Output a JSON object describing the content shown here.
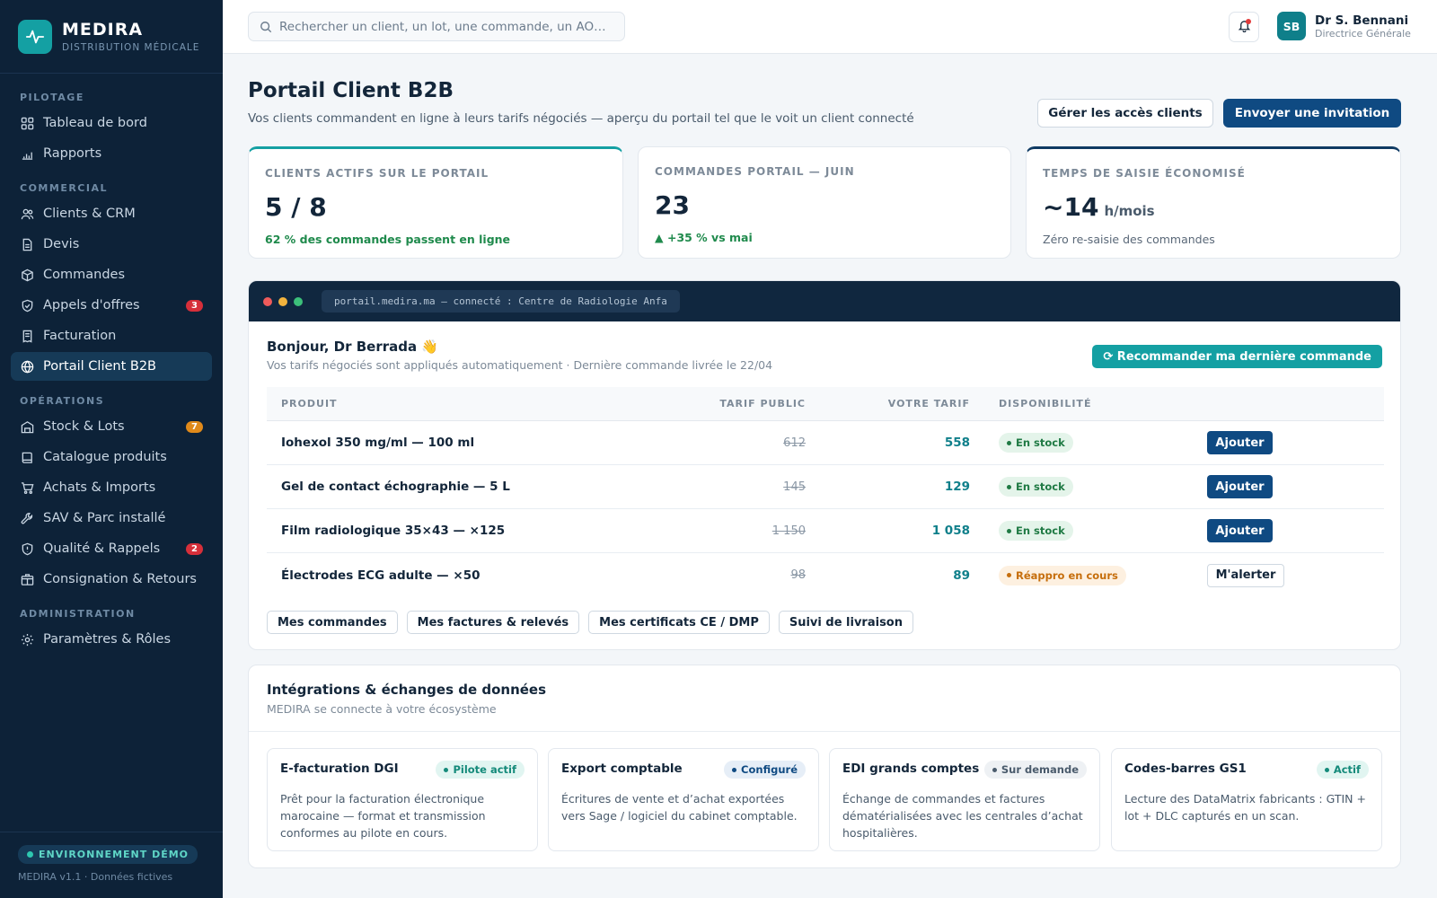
{
  "brand": {
    "name": "MEDIRA",
    "subtitle": "DISTRIBUTION MÉDICALE"
  },
  "sidebar": {
    "sections": [
      {
        "label": "PILOTAGE",
        "items": [
          {
            "label": "Tableau de bord",
            "icon": "grid-icon"
          },
          {
            "label": "Rapports",
            "icon": "bar-chart-icon"
          }
        ]
      },
      {
        "label": "COMMERCIAL",
        "items": [
          {
            "label": "Clients & CRM",
            "icon": "users-icon"
          },
          {
            "label": "Devis",
            "icon": "document-icon"
          },
          {
            "label": "Commandes",
            "icon": "box-icon"
          },
          {
            "label": "Appels d'offres",
            "icon": "shield-check-icon",
            "badge": "3"
          },
          {
            "label": "Facturation",
            "icon": "receipt-icon"
          },
          {
            "label": "Portail Client B2B",
            "icon": "globe-icon",
            "active": true
          }
        ]
      },
      {
        "label": "OPÉRATIONS",
        "items": [
          {
            "label": "Stock & Lots",
            "icon": "warehouse-icon",
            "badge": "7"
          },
          {
            "label": "Catalogue produits",
            "icon": "book-icon"
          },
          {
            "label": "Achats & Imports",
            "icon": "cart-icon"
          },
          {
            "label": "SAV & Parc installé",
            "icon": "wrench-icon"
          },
          {
            "label": "Qualité & Rappels",
            "icon": "shield-icon",
            "badge": "2"
          },
          {
            "label": "Consignation & Retours",
            "icon": "package-icon"
          }
        ]
      },
      {
        "label": "ADMINISTRATION",
        "items": [
          {
            "label": "Paramètres & Rôles",
            "icon": "gear-icon"
          }
        ]
      }
    ],
    "footer": {
      "env": "ENVIRONNEMENT DÉMO",
      "version": "MEDIRA v1.1 · Données fictives"
    }
  },
  "topbar": {
    "search_placeholder": "Rechercher un client, un lot, une commande, un AO…",
    "user": {
      "initials": "SB",
      "name": "Dr S. Bennani",
      "role": "Directrice Générale"
    }
  },
  "page": {
    "title": "Portail Client B2B",
    "subtitle": "Vos clients commandent en ligne à leurs tarifs négociés — aperçu du portail tel que le voit un client connecté",
    "btn_manage": "Gérer les accès clients",
    "btn_invite": "Envoyer une invitation"
  },
  "kpis": [
    {
      "label": "CLIENTS ACTIFS SUR LE PORTAIL",
      "value": "5 / 8",
      "unit": "",
      "note": "62 % des commandes passent en ligne"
    },
    {
      "label": "COMMANDES PORTAIL — JUIN",
      "value": "23",
      "unit": "",
      "note": "▲ +35 % vs mai"
    },
    {
      "label": "TEMPS DE SAISIE ÉCONOMISÉ",
      "value": "~14",
      "unit": "h/mois",
      "note": "Zéro re-saisie des commandes"
    }
  ],
  "portal": {
    "url": "portail.medira.ma — connecté : Centre de Radiologie Anfa",
    "greeting": "Bonjour, Dr Berrada 👋",
    "greeting_sub": "Vos tarifs négociés sont appliqués automatiquement · Dernière commande livrée le 22/04",
    "reorder_btn": "⟳ Recommander ma dernière commande",
    "columns": {
      "product": "PRODUIT",
      "public": "TARIF PUBLIC",
      "yours": "VOTRE TARIF",
      "availability": "DISPONIBILITÉ"
    },
    "rows": [
      {
        "product": "Iohexol 350 mg/ml — 100 ml",
        "public": "612",
        "yours": "558",
        "availability": "En stock",
        "action": "Ajouter"
      },
      {
        "product": "Gel de contact échographie — 5 L",
        "public": "145",
        "yours": "129",
        "availability": "En stock",
        "action": "Ajouter"
      },
      {
        "product": "Film radiologique 35×43 — ×125",
        "public": "1 150",
        "yours": "1 058",
        "availability": "En stock",
        "action": "Ajouter"
      },
      {
        "product": "Électrodes ECG adulte — ×50",
        "public": "98",
        "yours": "89",
        "availability": "Réappro en cours",
        "action": "M'alerter"
      }
    ],
    "links": [
      "Mes commandes",
      "Mes factures & relevés",
      "Mes certificats CE / DMP",
      "Suivi de livraison"
    ]
  },
  "integrations": {
    "title": "Intégrations & échanges de données",
    "subtitle": "MEDIRA se connecte à votre écosystème",
    "cards": [
      {
        "title": "E-facturation DGI",
        "status": "Pilote actif",
        "desc": "Prêt pour la facturation électronique marocaine — format et transmission conformes au pilote en cours."
      },
      {
        "title": "Export comptable",
        "status": "Configuré",
        "desc": "Écritures de vente et d’achat exportées vers Sage / logiciel du cabinet comptable."
      },
      {
        "title": "EDI grands comptes",
        "status": "Sur demande",
        "desc": "Échange de commandes et factures dématérialisées avec les centrales d’achat hospitalières."
      },
      {
        "title": "Codes-barres GS1",
        "status": "Actif",
        "desc": "Lecture des DataMatrix fabricants : GTIN + lot + DLC capturés en un scan."
      }
    ]
  },
  "colors": {
    "sidebar": "#0d2238",
    "teal": "#14a0a3",
    "primary": "#0f4a82",
    "green": "#1f8a4c",
    "orange": "#e08a1a",
    "red": "#d62f3a"
  }
}
